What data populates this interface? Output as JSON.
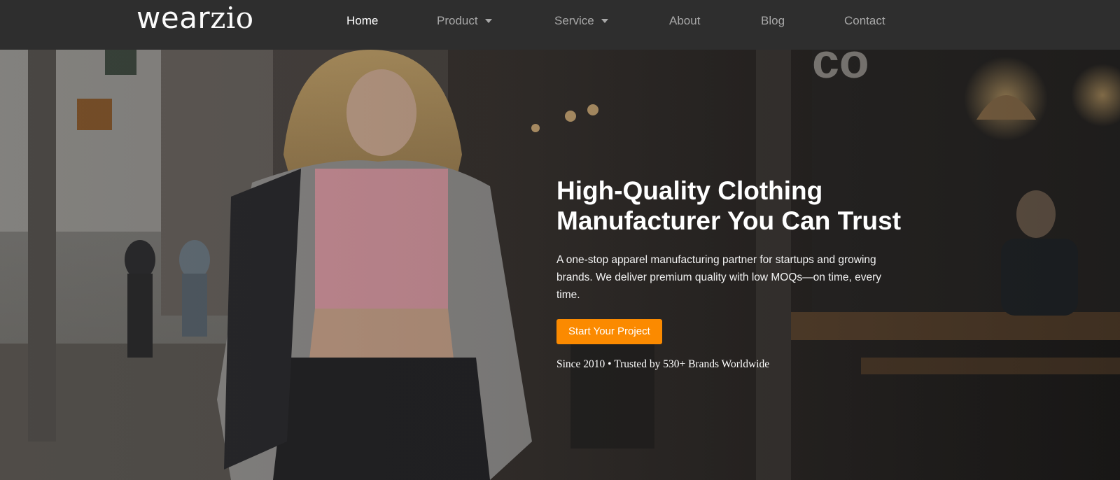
{
  "brand": {
    "logo_part1": "wear",
    "logo_part2": "zio"
  },
  "nav": {
    "items": [
      {
        "label": "Home",
        "active": true,
        "dropdown": false
      },
      {
        "label": "Product",
        "active": false,
        "dropdown": true
      },
      {
        "label": "Service",
        "active": false,
        "dropdown": true
      },
      {
        "label": "About",
        "active": false,
        "dropdown": false
      },
      {
        "label": "Blog",
        "active": false,
        "dropdown": false
      },
      {
        "label": "Contact",
        "active": false,
        "dropdown": false
      }
    ]
  },
  "hero": {
    "title_line1": "High-Quality Clothing",
    "title_line2": "Manufacturer You Can Trust",
    "description": "A one-stop apparel manufacturing partner for startups and growing brands. We deliver premium quality with low MOQs—on time, every time.",
    "cta_label": "Start Your Project",
    "tagline": "Since 2010 • Trusted by 530+ Brands Worldwide"
  },
  "colors": {
    "topbar": "#2e2e2e",
    "nav_text": "#a8a8a8",
    "nav_active": "#ffffff",
    "accent": "#fb8a00"
  },
  "icons": {
    "dropdown": "caret-down-icon"
  }
}
